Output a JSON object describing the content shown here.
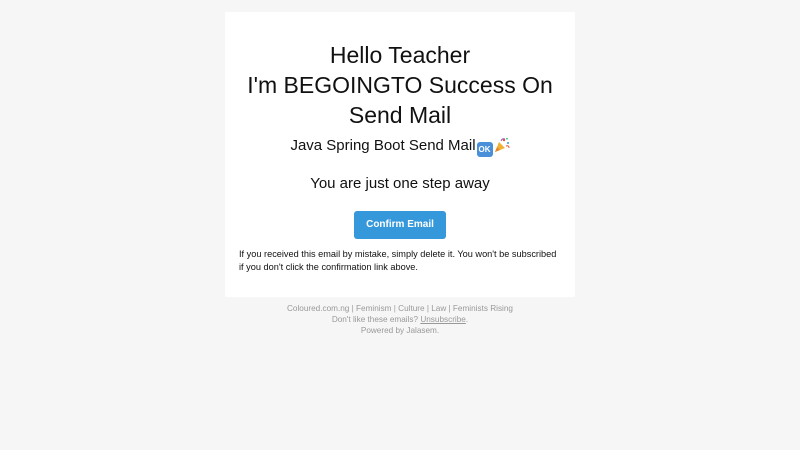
{
  "email": {
    "title_lines": [
      "Hello Teacher",
      "I'm BEGOINGTO Success On",
      "Send Mail"
    ],
    "subtitle": "Java Spring Boot Send Mail",
    "ok_emoji_text": "OK",
    "tagline": "You are just one step away",
    "confirm_button_label": "Confirm Email",
    "notice": "If you received this email by mistake, simply delete it. You won't be subscribed if you don't click the confirmation link above."
  },
  "footer": {
    "links_line": "Coloured.com.ng | Feminism | Culture | Law | Feminists Rising",
    "unsubscribe_prefix": "Don't like these emails?",
    "unsubscribe_link": "Unsubscribe",
    "unsubscribe_suffix": ".",
    "powered_by": "Powered by Jalasem."
  },
  "colors": {
    "page_background": "#f6f6f6",
    "card_background": "#ffffff",
    "button_background": "#3498db",
    "footer_text": "#999999"
  },
  "icons": [
    "ok-emoji-icon",
    "party-popper-icon"
  ]
}
